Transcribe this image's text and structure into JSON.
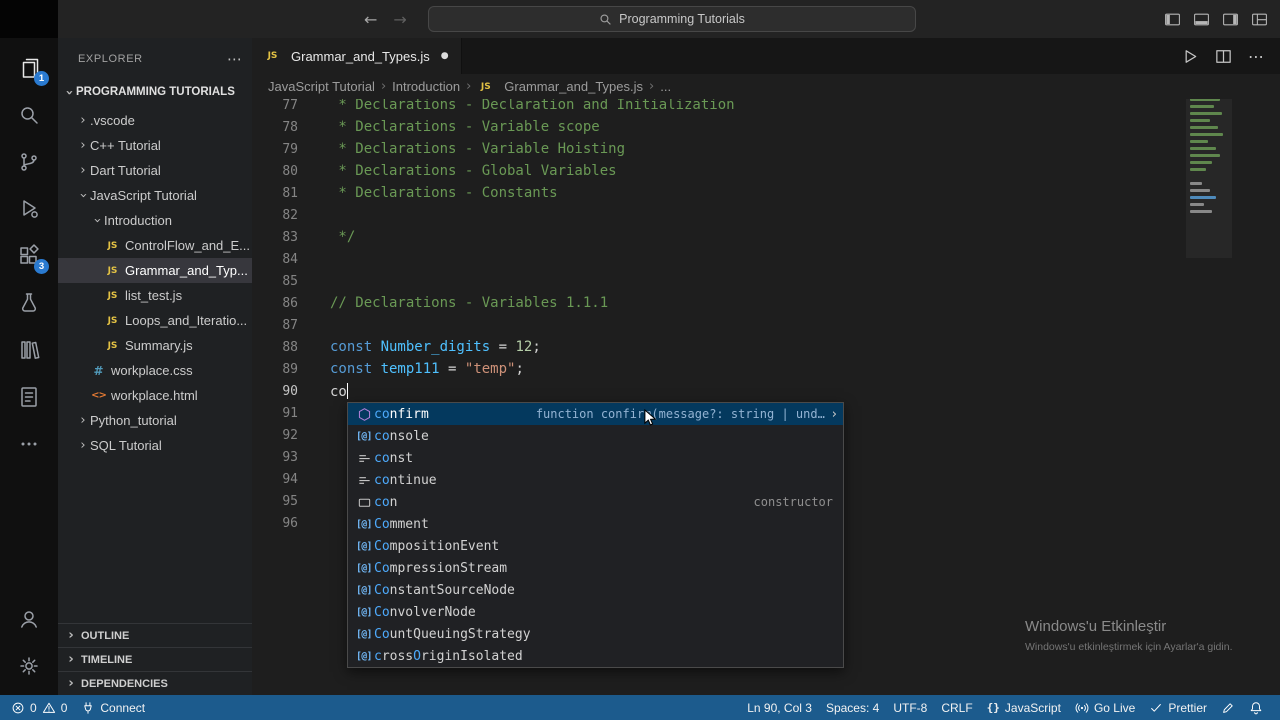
{
  "title_bar": {
    "search": "Programming Tutorials"
  },
  "activity_bar": {
    "items": [
      {
        "name": "explorer",
        "badge": "1"
      },
      {
        "name": "search"
      },
      {
        "name": "source-control"
      },
      {
        "name": "run-debug"
      },
      {
        "name": "extensions",
        "badge": "3"
      },
      {
        "name": "testing"
      },
      {
        "name": "library"
      },
      {
        "name": "notebook"
      },
      {
        "name": "more"
      }
    ],
    "bottom_items": [
      {
        "name": "account"
      },
      {
        "name": "settings"
      }
    ]
  },
  "sidebar": {
    "title": "EXPLORER",
    "section": "PROGRAMMING TUTORIALS",
    "tree": [
      {
        "label": ".vscode",
        "kind": "folder",
        "collapsed": true,
        "indent": 1
      },
      {
        "label": "C++ Tutorial",
        "kind": "folder",
        "collapsed": true,
        "indent": 1
      },
      {
        "label": "Dart Tutorial",
        "kind": "folder",
        "collapsed": true,
        "indent": 1
      },
      {
        "label": "JavaScript Tutorial",
        "kind": "folder",
        "collapsed": false,
        "indent": 1
      },
      {
        "label": "Introduction",
        "kind": "folder",
        "collapsed": false,
        "indent": 2
      },
      {
        "label": "ControlFlow_and_E...",
        "kind": "js",
        "indent": 3
      },
      {
        "label": "Grammar_and_Typ...",
        "kind": "js",
        "indent": 3,
        "selected": true
      },
      {
        "label": "list_test.js",
        "kind": "js",
        "indent": 3
      },
      {
        "label": "Loops_and_Iteratio...",
        "kind": "js",
        "indent": 3
      },
      {
        "label": "Summary.js",
        "kind": "js",
        "indent": 3
      },
      {
        "label": "workplace.css",
        "kind": "css",
        "indent": 2
      },
      {
        "label": "workplace.html",
        "kind": "html",
        "indent": 2
      },
      {
        "label": "Python_tutorial",
        "kind": "folder",
        "collapsed": true,
        "indent": 1
      },
      {
        "label": "SQL Tutorial",
        "kind": "folder",
        "collapsed": true,
        "indent": 1
      }
    ],
    "panels": [
      "OUTLINE",
      "TIMELINE",
      "DEPENDENCIES"
    ]
  },
  "editor": {
    "tab": {
      "label": "Grammar_and_Types.js",
      "modified": true
    },
    "breadcrumbs": [
      {
        "label": "JavaScript Tutorial"
      },
      {
        "label": "Introduction"
      },
      {
        "label": "Grammar_and_Types.js",
        "icon": "js"
      },
      {
        "label": "..."
      }
    ],
    "code": [
      {
        "n": 77,
        "tokens": [
          {
            "t": " * Declarations - Declaration and Initialization",
            "c": "cm"
          }
        ]
      },
      {
        "n": 78,
        "tokens": [
          {
            "t": " * Declarations - Variable scope",
            "c": "cm"
          }
        ]
      },
      {
        "n": 79,
        "tokens": [
          {
            "t": " * Declarations - Variable Hoisting",
            "c": "cm"
          }
        ]
      },
      {
        "n": 80,
        "tokens": [
          {
            "t": " * Declarations - Global Variables",
            "c": "cm"
          }
        ]
      },
      {
        "n": 81,
        "tokens": [
          {
            "t": " * Declarations - Constants",
            "c": "cm"
          }
        ]
      },
      {
        "n": 82,
        "tokens": []
      },
      {
        "n": 83,
        "tokens": [
          {
            "t": " */",
            "c": "cm"
          }
        ]
      },
      {
        "n": 84,
        "tokens": []
      },
      {
        "n": 85,
        "tokens": []
      },
      {
        "n": 86,
        "tokens": [
          {
            "t": "// Declarations - Variables 1.1.1",
            "c": "cm"
          }
        ]
      },
      {
        "n": 87,
        "tokens": []
      },
      {
        "n": 88,
        "tokens": [
          {
            "t": "const ",
            "c": "kw"
          },
          {
            "t": "Number_digits",
            "c": "vr"
          },
          {
            "t": " = ",
            "c": "pl"
          },
          {
            "t": "12",
            "c": "nm"
          },
          {
            "t": ";",
            "c": "pl"
          }
        ]
      },
      {
        "n": 89,
        "tokens": [
          {
            "t": "const ",
            "c": "kw"
          },
          {
            "t": "temp111",
            "c": "vr"
          },
          {
            "t": " = ",
            "c": "pl"
          },
          {
            "t": "\"temp\"",
            "c": "st"
          },
          {
            "t": ";",
            "c": "pl"
          }
        ]
      },
      {
        "n": 90,
        "tokens": [
          {
            "t": "co",
            "c": "pl"
          }
        ],
        "cursor": true
      },
      {
        "n": 91,
        "tokens": []
      },
      {
        "n": 92,
        "tokens": []
      },
      {
        "n": 93,
        "tokens": []
      },
      {
        "n": 94,
        "tokens": []
      },
      {
        "n": 95,
        "tokens": []
      },
      {
        "n": 96,
        "tokens": []
      }
    ]
  },
  "suggest": {
    "selected_detail": "function confirm(message?: string | und…",
    "items": [
      {
        "icon": "method",
        "selected": true,
        "parts": [
          [
            "co",
            1
          ],
          [
            "nfirm",
            0
          ]
        ]
      },
      {
        "icon": "variable",
        "parts": [
          [
            "co",
            1
          ],
          [
            "nsole",
            0
          ]
        ]
      },
      {
        "icon": "keyword",
        "parts": [
          [
            "co",
            1
          ],
          [
            "nst",
            0
          ]
        ]
      },
      {
        "icon": "keyword",
        "parts": [
          [
            "co",
            1
          ],
          [
            "ntinue",
            0
          ]
        ]
      },
      {
        "icon": "text",
        "parts": [
          [
            "co",
            1
          ],
          [
            "n",
            0
          ]
        ],
        "right": "constructor"
      },
      {
        "icon": "variable",
        "parts": [
          [
            "Co",
            1
          ],
          [
            "mment",
            0
          ]
        ]
      },
      {
        "icon": "variable",
        "parts": [
          [
            "Co",
            1
          ],
          [
            "mpositionEvent",
            0
          ]
        ]
      },
      {
        "icon": "variable",
        "parts": [
          [
            "Co",
            1
          ],
          [
            "mpressionStream",
            0
          ]
        ]
      },
      {
        "icon": "variable",
        "parts": [
          [
            "Co",
            1
          ],
          [
            "nstantSourceNode",
            0
          ]
        ]
      },
      {
        "icon": "variable",
        "parts": [
          [
            "Co",
            1
          ],
          [
            "nvolverNode",
            0
          ]
        ]
      },
      {
        "icon": "variable",
        "parts": [
          [
            "Co",
            1
          ],
          [
            "untQueuingStrategy",
            0
          ]
        ]
      },
      {
        "icon": "variable",
        "parts": [
          [
            "c",
            1
          ],
          [
            "ross",
            0
          ],
          [
            "O",
            1
          ],
          [
            "riginIsolated",
            0
          ]
        ]
      }
    ]
  },
  "status_bar": {
    "errors": "0",
    "warnings": "0",
    "connect_label": "Connect",
    "right_items": [
      {
        "name": "cursor-position",
        "label": "Ln 90, Col 3"
      },
      {
        "name": "indentation",
        "label": "Spaces: 4"
      },
      {
        "name": "encoding",
        "label": "UTF-8"
      },
      {
        "name": "eol",
        "label": "CRLF"
      },
      {
        "name": "language-mode",
        "label": "JavaScript",
        "icon": "braces"
      },
      {
        "name": "go-live",
        "label": "Go Live",
        "icon": "broadcast"
      },
      {
        "name": "prettier",
        "label": "Prettier",
        "icon": "check"
      },
      {
        "name": "edit",
        "label": "",
        "icon": "pencil"
      },
      {
        "name": "notifications",
        "label": "",
        "icon": "bell"
      }
    ]
  },
  "watermark": {
    "line1": "Windows'u Etkinleştir",
    "line2": "Windows'u etkinleştirmek için Ayarlar'a gidin."
  }
}
